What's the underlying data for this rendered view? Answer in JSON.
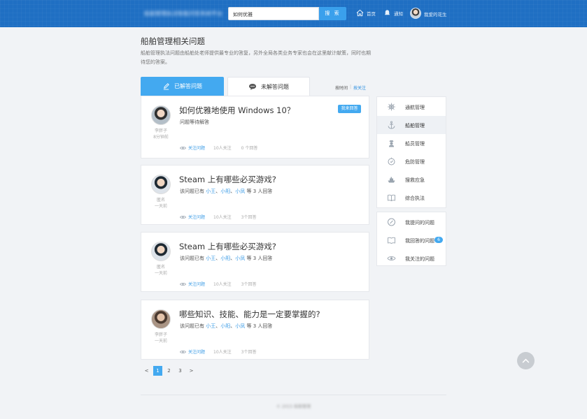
{
  "header": {
    "logo_text": "船舶管理执法智能问答系统平台",
    "search_value": "如何优雅",
    "search_button": "搜 索",
    "nav_home": "首页",
    "nav_notify": "通知",
    "user_name": "我爱的花生"
  },
  "intro": {
    "title": "船舶管理相关问题",
    "description": "船舶管理执法问题由船舶处老师提供最专业的答复，另外全局各类业务专家也会在这里献计献策，同时也期待您的答案。"
  },
  "tabs": [
    {
      "label": "已解答问题",
      "icon": "pencil-icon",
      "selected": true
    },
    {
      "label": "未解答问题",
      "icon": "comment-icon",
      "selected": false
    }
  ],
  "sort": {
    "time": "按时间",
    "sep": "|",
    "follow": "按关注"
  },
  "questions": [
    {
      "title": "如何优雅地使用 Windows 10？",
      "author": "李胖子",
      "time": "8分钟前",
      "status": "问题等待解答",
      "answer_button": "我来回答",
      "follow": "关注问题",
      "followers": "10人关注",
      "answers": "0 个回答"
    },
    {
      "title": "Steam 上有哪些必买游戏?",
      "author": "匿名",
      "time": "一天前",
      "prefix": "该问题已有",
      "answerers": [
        "小王",
        "小阳",
        "小凤"
      ],
      "suffix": "等 3 人回答",
      "follow": "关注问题",
      "followers": "10人关注",
      "answers": "3个回答"
    },
    {
      "title": "Steam 上有哪些必买游戏?",
      "author": "匿名",
      "time": "一天前",
      "prefix": "该问题已有",
      "answerers": [
        "小王",
        "小阳",
        "小凤"
      ],
      "suffix": "等 3 人回答",
      "follow": "关注问题",
      "followers": "10人关注",
      "answers": "3个回答"
    },
    {
      "title": "哪些知识、技能、能力是一定要掌握的?",
      "author": "李胖子",
      "time": "一天前",
      "prefix": "该问题已有",
      "answerers": [
        "小王",
        "小阳",
        "小凤"
      ],
      "suffix": "等 3 人回答",
      "follow": "关注问题",
      "followers": "10人关注",
      "answers": "3个回答"
    }
  ],
  "pagination": {
    "prev": "<",
    "pages": [
      "1",
      "2",
      "3"
    ],
    "current": "1",
    "next": ">"
  },
  "footer": {
    "text": "© 2015 船舶管理"
  },
  "sidebar": {
    "categories": [
      {
        "label": "通航管理",
        "icon": "helm-icon",
        "active": false
      },
      {
        "label": "船舶管理",
        "icon": "anchor-icon",
        "active": true
      },
      {
        "label": "船员管理",
        "icon": "sailor-icon",
        "active": false
      },
      {
        "label": "危防管理",
        "icon": "shield-icon",
        "active": false
      },
      {
        "label": "搜救应急",
        "icon": "ship-icon",
        "active": false
      },
      {
        "label": "综合执法",
        "icon": "book-icon",
        "active": false
      }
    ],
    "my": [
      {
        "label": "我提问的问题",
        "icon": "question-icon"
      },
      {
        "label": "我回答的问题",
        "icon": "answer-icon",
        "badge": "6"
      },
      {
        "label": "我关注的问题",
        "icon": "eye-icon"
      }
    ]
  }
}
